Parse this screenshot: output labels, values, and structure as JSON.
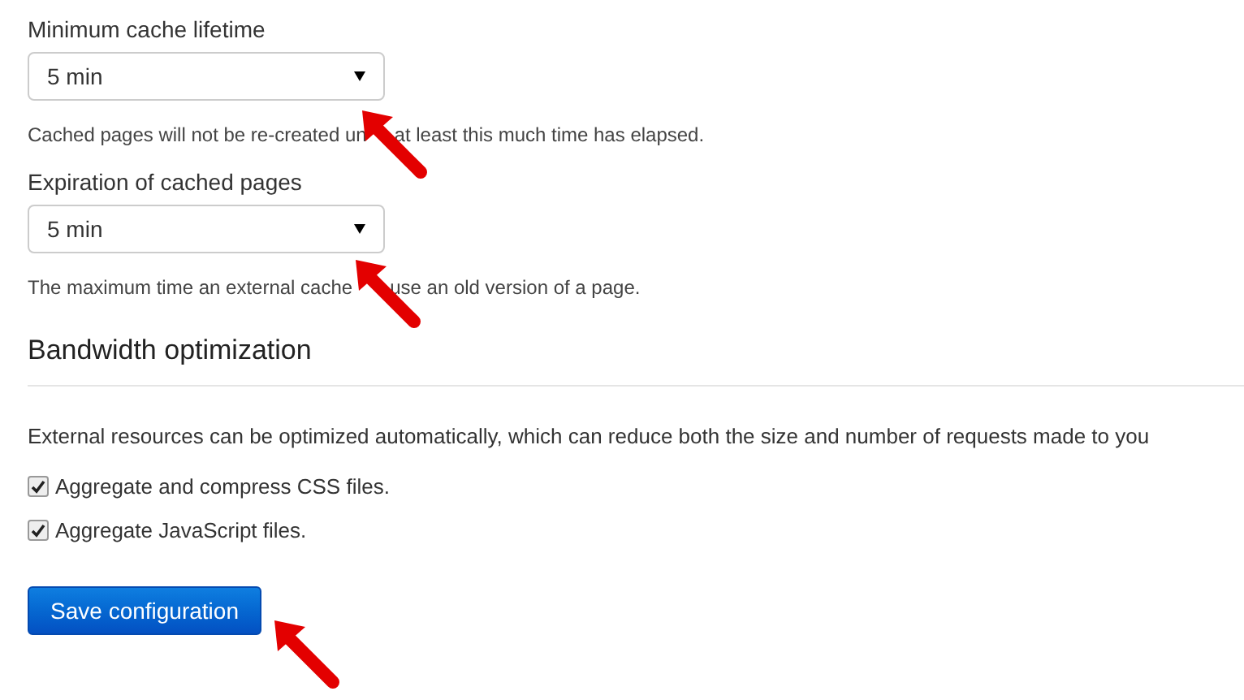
{
  "cache": [
    {
      "label": "Minimum cache lifetime",
      "value": "5 min",
      "description_parts": [
        "Cached pages will not be re-created un",
        "at least this much time has elapsed."
      ]
    },
    {
      "label": "Expiration of cached pages",
      "value": "5 min",
      "description_parts": [
        "The maximum time an external cache",
        "use an old version of a page."
      ]
    }
  ],
  "bandwidth": {
    "heading": "Bandwidth optimization",
    "description": "External resources can be optimized automatically, which can reduce both the size and number of requests made to you",
    "options": [
      {
        "label": "Aggregate and compress CSS files.",
        "checked": true
      },
      {
        "label": "Aggregate JavaScript files.",
        "checked": true
      }
    ]
  },
  "save_button": "Save configuration"
}
